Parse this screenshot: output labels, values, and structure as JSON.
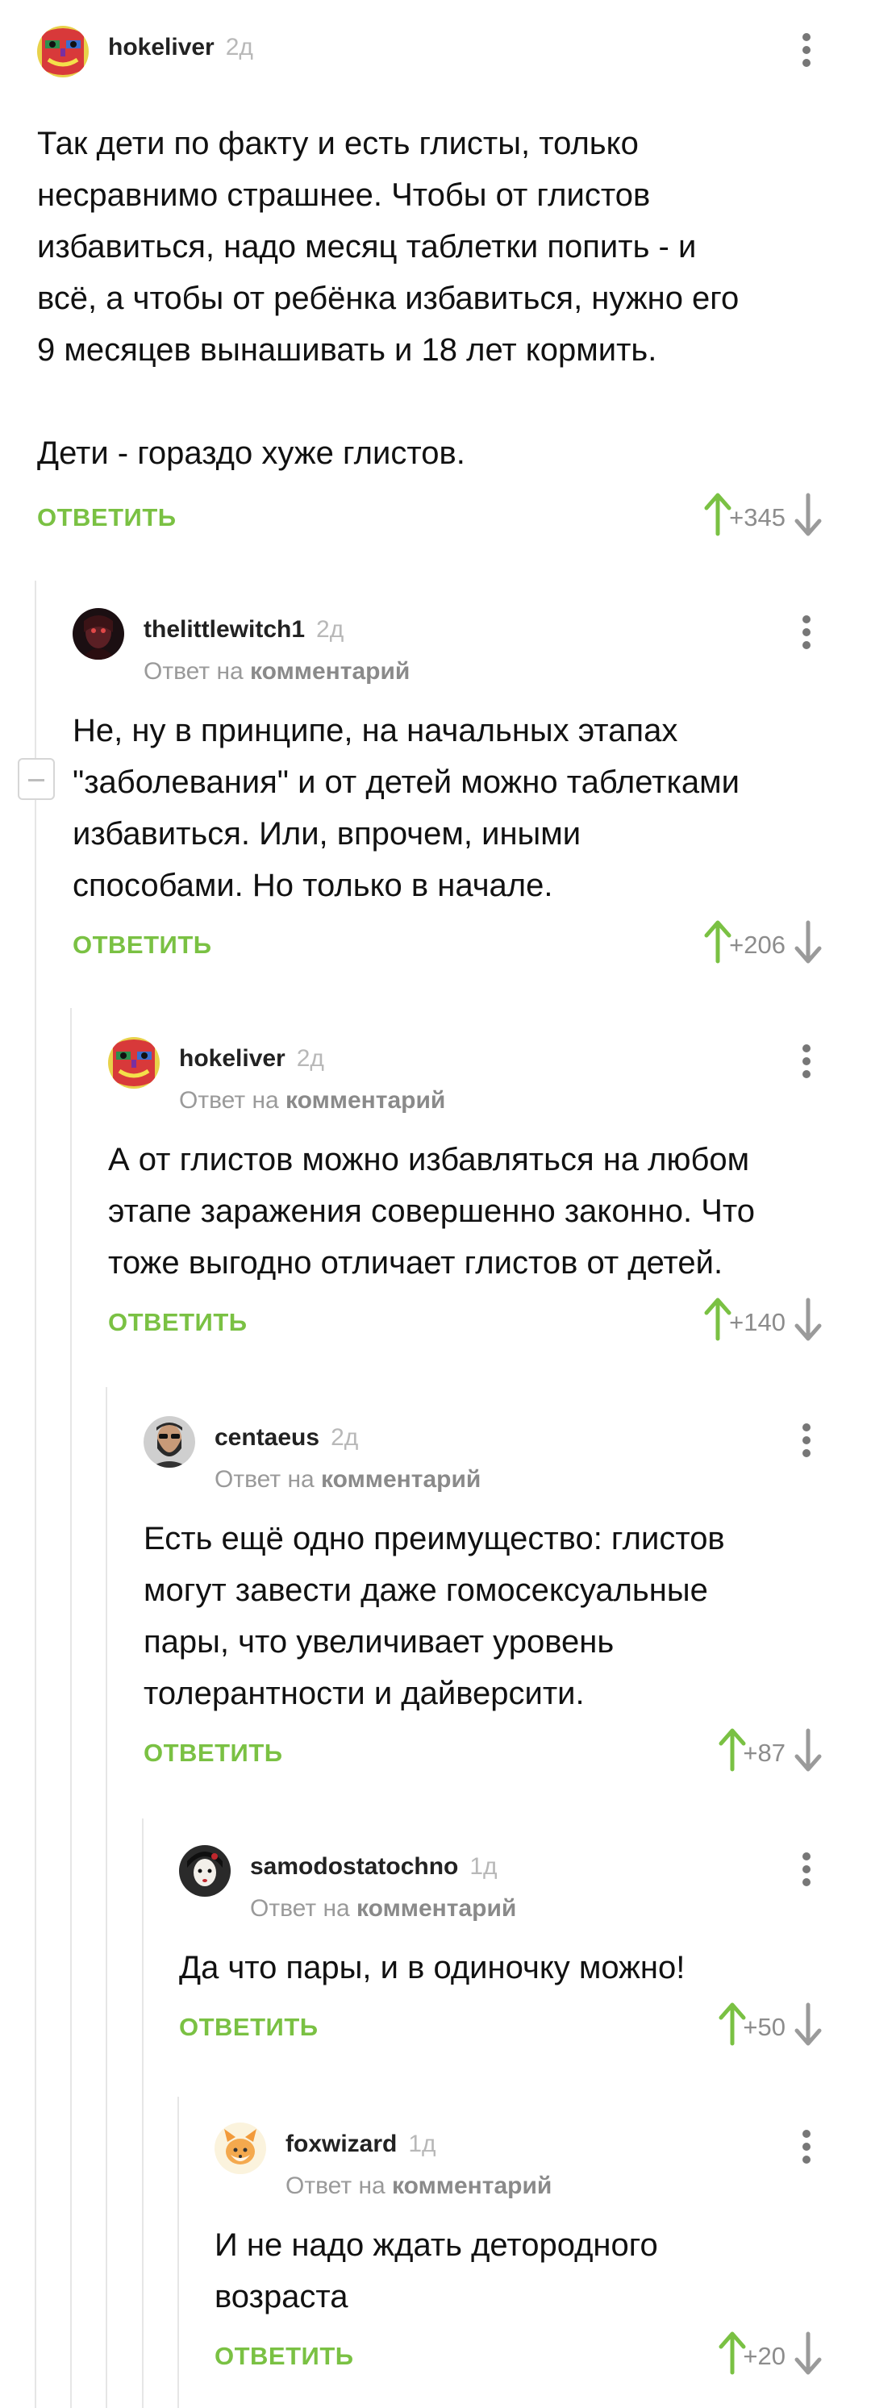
{
  "reply_prefix": "Ответ на",
  "reply_target": "комментарий",
  "reply_label": "ОТВЕТИТЬ",
  "colors": {
    "accent_green": "#7ac143",
    "score_gray": "#8c8c8c",
    "thread_line": "#e6e6e6"
  },
  "comments": [
    {
      "username": "hokeliver",
      "age": "2д",
      "avatar_icon": "colorful-mask-avatar",
      "body": "Так дети по факту и есть глисты, только\nнесравнимо страшнее. Чтобы от глистов\nизбавиться, надо месяц таблетки попить - и\nвсё, а чтобы от ребёнка избавиться, нужно его\n9 месяцев вынашивать и 18 лет кормить.\n\nДети - гораздо хуже глистов.",
      "score": "+345"
    },
    {
      "username": "thelittlewitch1",
      "age": "2д",
      "avatar_icon": "dark-portrait-avatar",
      "body": "Не, ну в принципе, на начальных этапах\n\"заболевания\" и от детей можно таблетками\nизбавиться. Или, впрочем, иными\nспособами. Но только в начале.",
      "score": "+206"
    },
    {
      "username": "hokeliver",
      "age": "2д",
      "avatar_icon": "colorful-mask-avatar",
      "body": "А от глистов можно избавляться на любом\nэтапе заражения совершенно законно. Что\nтоже выгодно отличает глистов от детей.",
      "score": "+140"
    },
    {
      "username": "centaeus",
      "age": "2д",
      "avatar_icon": "bearded-man-avatar",
      "body": "Есть ещё одно преимущество: глистов\nмогут завести даже гомосексуальные\nпары, что увеличивает уровень\nтолерантности и дайверсити.",
      "score": "+87"
    },
    {
      "username": "samodostatochno",
      "age": "1д",
      "avatar_icon": "geisha-avatar",
      "body": "Да что пары, и в одиночку можно!",
      "score": "+50"
    },
    {
      "username": "foxwizard",
      "age": "1д",
      "avatar_icon": "cartoon-fox-avatar",
      "body": "И не надо ждать детородного\nвозраста",
      "score": "+20"
    }
  ]
}
